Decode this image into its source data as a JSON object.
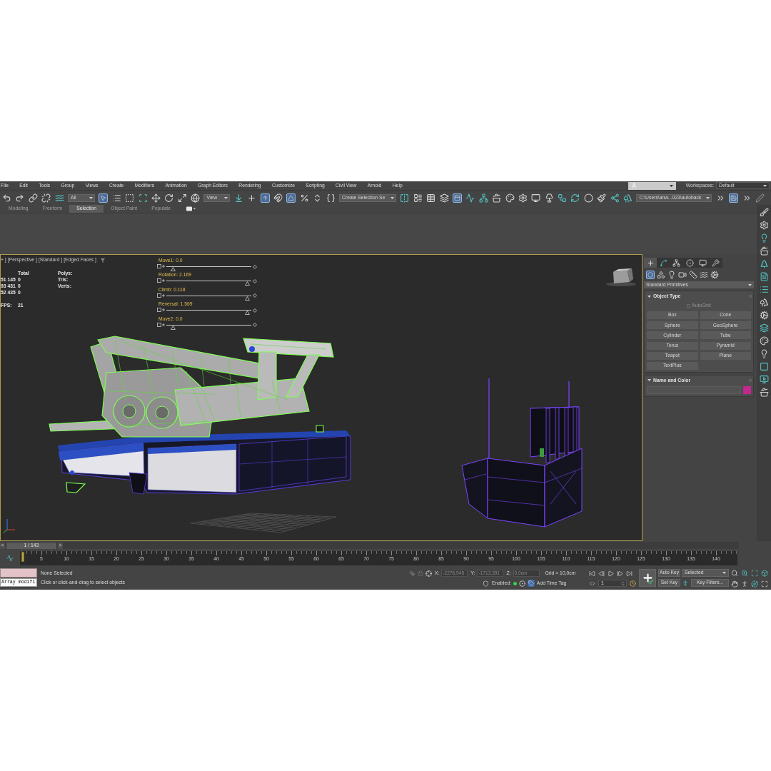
{
  "menu_bar": {
    "items": [
      "File",
      "Edit",
      "Tools",
      "Group",
      "Views",
      "Create",
      "Modifiers",
      "Animation",
      "Graph Editors",
      "Rendering",
      "Customize",
      "Scripting",
      "Civil View",
      "Arnold",
      "Help"
    ],
    "workspaces_label": "Workspaces:",
    "workspace": "Default"
  },
  "main_toolbar": [
    {
      "kind": "icon",
      "on": false
    },
    {
      "kind": "icon",
      "on": false
    },
    {
      "kind": "icon",
      "on": false
    },
    {
      "kind": "icon",
      "on": false
    },
    {
      "kind": "icon",
      "on": false
    },
    {
      "kind": "dropdown",
      "value": "All"
    },
    {
      "kind": "icon",
      "on": true
    },
    {
      "kind": "icon",
      "on": false
    },
    {
      "kind": "icon",
      "on": false
    },
    {
      "kind": "icon",
      "on": false
    },
    {
      "kind": "icon",
      "on": false
    },
    {
      "kind": "icon",
      "on": false
    },
    {
      "kind": "icon",
      "on": false
    },
    {
      "kind": "icon",
      "on": false
    },
    {
      "kind": "dropdown",
      "value": "View"
    },
    {
      "kind": "icon",
      "on": false
    },
    {
      "kind": "icon",
      "on": false
    },
    {
      "kind": "icon",
      "on": true
    },
    {
      "kind": "icon",
      "on": false
    },
    {
      "kind": "icon",
      "on": true
    },
    {
      "kind": "icon",
      "on": false
    },
    {
      "kind": "icon",
      "on": false
    },
    {
      "kind": "icon",
      "on": false
    },
    {
      "kind": "dropdown",
      "value": "Create Selection Se"
    },
    {
      "kind": "icon",
      "on": false
    },
    {
      "kind": "icon",
      "on": false
    },
    {
      "kind": "icon",
      "on": false
    },
    {
      "kind": "icon",
      "on": false
    },
    {
      "kind": "icon",
      "on": true
    },
    {
      "kind": "icon",
      "on": false
    },
    {
      "kind": "icon",
      "on": false
    },
    {
      "kind": "icon",
      "on": false
    },
    {
      "kind": "icon",
      "on": false
    },
    {
      "kind": "icon",
      "on": false
    },
    {
      "kind": "icon",
      "on": false
    },
    {
      "kind": "icon",
      "on": false
    },
    {
      "kind": "icon",
      "on": false
    },
    {
      "kind": "icon",
      "on": false
    },
    {
      "kind": "icon",
      "on": false
    },
    {
      "kind": "icon",
      "on": false
    },
    {
      "kind": "icon",
      "on": false
    },
    {
      "kind": "icon",
      "on": false
    },
    {
      "kind": "dropdown",
      "value": "C:\\Users\\anw...023\\autoback"
    },
    {
      "kind": "icon",
      "on": false
    },
    {
      "kind": "icon",
      "on": true
    },
    {
      "kind": "icon",
      "on": false
    },
    {
      "kind": "icon",
      "on": false
    }
  ],
  "ribbon": {
    "tabs": [
      {
        "label": "Modeling",
        "selected": false
      },
      {
        "label": "Freeform",
        "selected": false
      },
      {
        "label": "Selection",
        "selected": true
      },
      {
        "label": "Object Paint",
        "selected": false
      },
      {
        "label": "Populate",
        "selected": false
      }
    ]
  },
  "viewport": {
    "active": true,
    "labels": [
      "+ ]",
      "[Perspective ]",
      "[Standard ]",
      "[Edged Faces ]"
    ],
    "statistics": {
      "header": "Total",
      "rows": [
        {
          "label": "Polys:",
          "total": "51 145",
          "selection": "0"
        },
        {
          "label": "Tris:",
          "total": "93 431",
          "selection": "0"
        },
        {
          "label": "Verts:",
          "total": "52 435",
          "selection": "0"
        }
      ],
      "fps_label": "FPS:",
      "fps": "21"
    },
    "manipulators": [
      {
        "label": "Move1: 0.0",
        "level": 0.05
      },
      {
        "label": "Rotation: 2.169",
        "level": 0.98
      },
      {
        "label": "Climb: 0.118",
        "level": 0.98
      },
      {
        "label": "Reversal: 1.569",
        "level": 0.98
      },
      {
        "label": "Muve2: 0.0",
        "level": 0.05
      }
    ]
  },
  "command_panel": {
    "tabs": [
      {
        "selected": true
      },
      {
        "selected": false
      },
      {
        "selected": false
      },
      {
        "selected": false
      },
      {
        "selected": false
      },
      {
        "selected": false
      }
    ],
    "categories": [
      {
        "selected": true
      },
      {
        "selected": false
      },
      {
        "selected": false
      },
      {
        "selected": false
      },
      {
        "selected": false
      },
      {
        "selected": false
      },
      {
        "selected": false
      }
    ],
    "object_class": "Standard Primitives",
    "rollouts": [
      {
        "kind": "object_type",
        "title": "Object Type",
        "expanded": true,
        "autogrid": {
          "label": "AutoGrid",
          "checked": false,
          "disabled": true
        },
        "buttons": [
          "Box",
          "Cone",
          "Sphere",
          "GeoSphere",
          "Cylinder",
          "Tube",
          "Torus",
          "Pyramid",
          "Teapot",
          "Plane",
          "TextPlus"
        ]
      },
      {
        "kind": "name_and_color",
        "title": "Name and Color",
        "expanded": true,
        "color": "#c4288e"
      }
    ]
  },
  "timeline": {
    "slider": {
      "prev": "<",
      "label": "1 / 143",
      "next": ">",
      "level": 0
    },
    "ticks": [
      "5",
      "10",
      "15",
      "20",
      "25",
      "30",
      "35",
      "40",
      "45",
      "50",
      "55",
      "60",
      "65",
      "70",
      "75",
      "80",
      "85",
      "90",
      "95",
      "100",
      "105",
      "110",
      "115",
      "120",
      "125",
      "130",
      "135",
      "140"
    ]
  },
  "status_bar": {
    "listener_output": "Array modifi",
    "selection_info": "None Selected",
    "prompt": "Click or click-and-drag to select objects",
    "coordinates": [
      {
        "label": "X:",
        "value": "-2276,945",
        "disabled": true
      },
      {
        "label": "Y:",
        "value": "-1713,391",
        "disabled": true
      },
      {
        "label": "Z:",
        "value": "0,0cm",
        "disabled": true
      }
    ],
    "grid": "Grid = 10,0cm",
    "degradation": {
      "label": "Enabled:",
      "on": true
    },
    "time_tag": "Add Time Tag",
    "current_frame": "1",
    "auto_key": {
      "label": "Auto Key",
      "on": false
    },
    "key_set": "Selected",
    "set_key": "Set Key",
    "key_filters": "Key Filters..."
  }
}
